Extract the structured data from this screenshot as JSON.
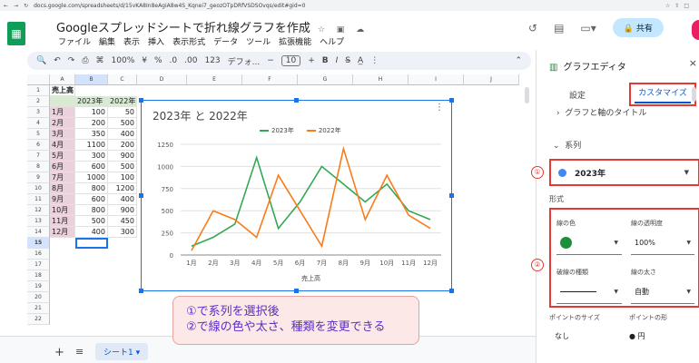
{
  "browser": {
    "url": "docs.google.com/spreadsheets/d/15vKA8In8eAgiA8w4S_Kqnei7_geozOTpDRfVSDSOvqs/edit#gid=0"
  },
  "app": {
    "title": "Googleスプレッドシートで折れ線グラフを作成",
    "menu": [
      "ファイル",
      "編集",
      "表示",
      "挿入",
      "表示形式",
      "データ",
      "ツール",
      "拡張機能",
      "ヘルプ"
    ],
    "share_label": "共有"
  },
  "toolbar": {
    "zoom": "100%",
    "currency": "¥",
    "percent": "%",
    "dec_dec": ".0",
    "inc_dec": ".00",
    "format123": "123",
    "font": "デフォ...",
    "font_size": "10",
    "bold": "B",
    "italic": "I"
  },
  "grid": {
    "columns": [
      "A",
      "B",
      "C",
      "D",
      "E",
      "F",
      "G",
      "H",
      "I",
      "J"
    ],
    "rows": [
      "1",
      "2",
      "3",
      "4",
      "5",
      "6",
      "7",
      "8",
      "9",
      "10",
      "11",
      "12",
      "13",
      "14",
      "15",
      "16",
      "17",
      "18",
      "19",
      "20",
      "21",
      "22"
    ],
    "table_title": "売上高",
    "header": [
      "",
      "2023年",
      "2022年"
    ],
    "months": [
      "1月",
      "2月",
      "3月",
      "4月",
      "5月",
      "6月",
      "7月",
      "8月",
      "9月",
      "10月",
      "11月",
      "12月"
    ],
    "y2023": [
      100,
      200,
      350,
      1100,
      300,
      600,
      1000,
      800,
      600,
      800,
      500,
      400
    ],
    "y2022": [
      50,
      500,
      400,
      200,
      900,
      500,
      100,
      1200,
      400,
      900,
      450,
      300
    ]
  },
  "chart_data": {
    "type": "line",
    "title": "2023年 と 2022年",
    "categories": [
      "1月",
      "2月",
      "3月",
      "4月",
      "5月",
      "6月",
      "7月",
      "8月",
      "9月",
      "10月",
      "11月",
      "12月"
    ],
    "series": [
      {
        "name": "2023年",
        "color": "#34a853",
        "values": [
          100,
          200,
          350,
          1100,
          300,
          600,
          1000,
          800,
          600,
          800,
          500,
          400
        ]
      },
      {
        "name": "2022年",
        "color": "#fa7b17",
        "values": [
          50,
          500,
          400,
          200,
          900,
          500,
          100,
          1200,
          400,
          900,
          450,
          300
        ]
      }
    ],
    "xlabel": "売上高",
    "ylabel": "",
    "ylim": [
      0,
      1250
    ],
    "yticks": [
      "0",
      "250",
      "500",
      "750",
      "1000",
      "1250"
    ],
    "grid": true,
    "legend": "top"
  },
  "sheet": {
    "tab_label": "シート1",
    "add_icon": "+",
    "all_icon": "≡"
  },
  "callout": {
    "line1": "①で系列を選択後",
    "line2": "②で線の色や太さ、種類を変更できる"
  },
  "panel": {
    "title": "グラフエディタ",
    "tab_setup": "設定",
    "tab_customize": "カスタマイズ",
    "section_title": "グラフと軸のタイトル",
    "section_series": "系列",
    "badge1": "①",
    "badge2": "②",
    "series_selected": "2023年",
    "format_label": "形式",
    "line_color_label": "線の色",
    "line_opacity_label": "線の透明度",
    "line_opacity_value": "100%",
    "dash_type_label": "破線の種類",
    "line_width_label": "線の太さ",
    "line_width_value": "自動",
    "point_size_label": "ポイントのサイズ",
    "point_shape_label": "ポイントの形",
    "point_size_value": "なし",
    "point_shape_value": "● 円"
  }
}
